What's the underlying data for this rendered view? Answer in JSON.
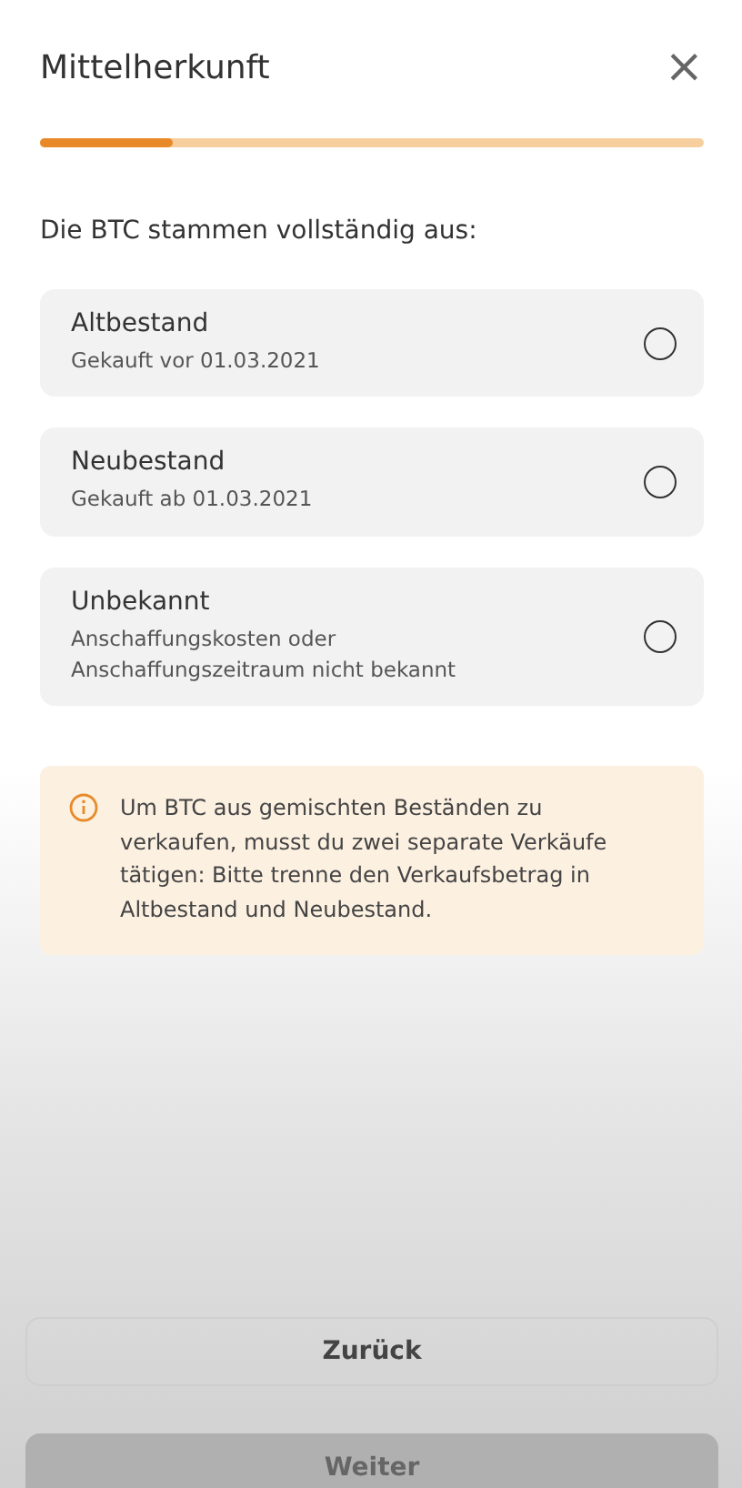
{
  "dialog": {
    "title": "Mittelherkunft",
    "close": "×"
  },
  "progress": {
    "level": 0.2
  },
  "question": "Die BTC stammen vollständig aus:",
  "options": [
    {
      "title": "Altbestand",
      "subtitle": "Gekauft vor 01.03.2021",
      "selected": false
    },
    {
      "title": "Neubestand",
      "subtitle": "Gekauft ab 01.03.2021",
      "selected": false
    },
    {
      "title": "Unbekannt",
      "subtitle": "Anschaffungskosten oder Anschaffungszeitraum nicht bekannt",
      "selected": false
    }
  ],
  "info": {
    "text": "Um BTC aus gemischten Beständen zu verkaufen, musst du zwei separate Verkäufe tätigen: Bitte trenne den Verkaufsbetrag in Altbestand und Neubestand."
  },
  "buttons": [
    {
      "label": "Zurück",
      "disabled": false
    },
    {
      "label": "Weiter",
      "disabled": true
    }
  ]
}
